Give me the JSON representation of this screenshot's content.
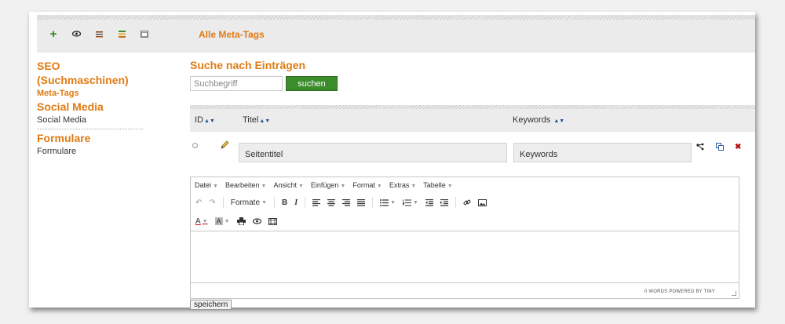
{
  "toolbar": {
    "page_title": "Alle Meta-Tags"
  },
  "sidebar": {
    "groups": [
      {
        "heading": "SEO (Suchmaschinen)",
        "items": [
          "Meta-Tags"
        ]
      },
      {
        "heading": "Social Media",
        "items": [
          "Social Media"
        ]
      },
      {
        "heading": "Formulare",
        "items": [
          "Formulare"
        ]
      }
    ]
  },
  "search": {
    "title": "Suche nach Einträgen",
    "placeholder": "Suchbegriff",
    "button": "suchen"
  },
  "table": {
    "columns": [
      "ID",
      "Titel",
      "Keywords"
    ],
    "sort_glyph": "▲▼",
    "row": {
      "title_value": "Seitentitel",
      "keywords_value": "Keywords"
    }
  },
  "editor": {
    "menus": [
      "Datei",
      "Bearbeiten",
      "Ansicht",
      "Einfügen",
      "Format",
      "Extras",
      "Tabelle"
    ],
    "formats_label": "Formate",
    "status": "0 WORDS POWERED BY TINY"
  },
  "save_button": "speichern",
  "colors": {
    "accent": "#e07b14",
    "button_green": "#3b8c2a",
    "header_bg": "#ebebeb"
  }
}
